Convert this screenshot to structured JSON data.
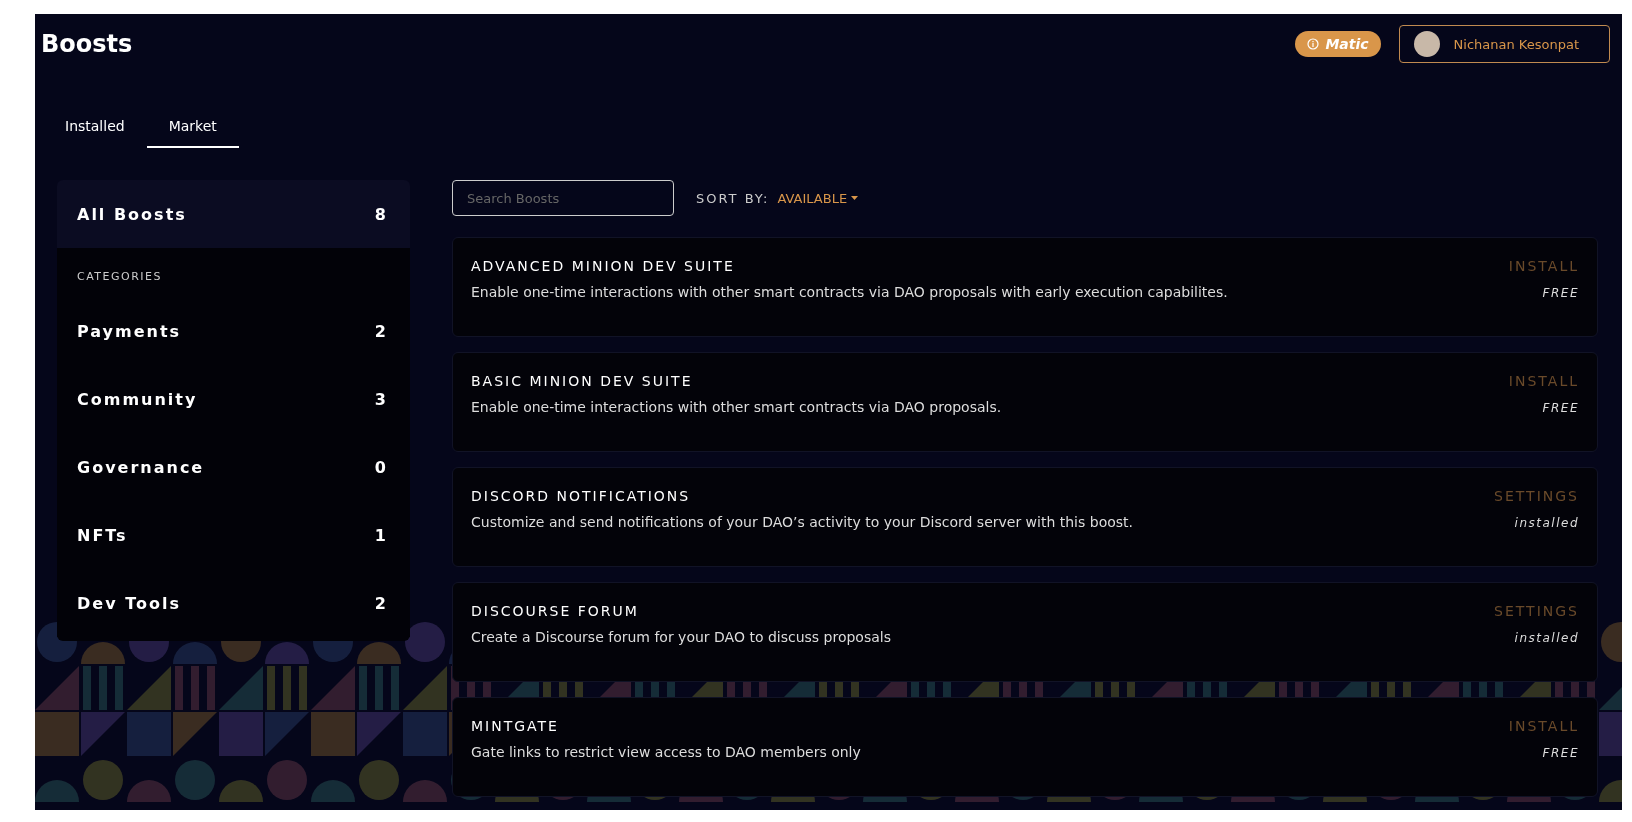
{
  "header": {
    "title": "Boosts",
    "network": "Matic",
    "user": "Nichanan Kesonpat"
  },
  "tabs": [
    {
      "label": "Installed",
      "selected": false
    },
    {
      "label": "Market",
      "selected": true
    }
  ],
  "sidebar": {
    "all": {
      "label": "All Boosts",
      "count": "8",
      "selected": true
    },
    "categories_heading": "CATEGORIES",
    "categories": [
      {
        "label": "Payments",
        "count": "2",
        "selected": false
      },
      {
        "label": "Community",
        "count": "3",
        "selected": false
      },
      {
        "label": "Governance",
        "count": "0",
        "selected": false
      },
      {
        "label": "NFTs",
        "count": "1",
        "selected": false
      },
      {
        "label": "Dev Tools",
        "count": "2",
        "selected": false
      }
    ]
  },
  "search": {
    "placeholder": "Search Boosts"
  },
  "sort": {
    "label": "SORT BY:",
    "value": "AVAILABLE"
  },
  "boosts": [
    {
      "title": "ADVANCED MINION DEV SUITE",
      "description": "Enable one-time interactions with other smart contracts via DAO proposals with early execution capabilites.",
      "action": "INSTALL",
      "status": "FREE"
    },
    {
      "title": "BASIC MINION DEV SUITE",
      "description": "Enable one-time interactions with other smart contracts via DAO proposals.",
      "action": "INSTALL",
      "status": "FREE"
    },
    {
      "title": "DISCORD NOTIFICATIONS",
      "description": "Customize and send notifications of your DAO’s activity to your Discord server with this boost.",
      "action": "SETTINGS",
      "status": "installed"
    },
    {
      "title": "DISCOURSE FORUM",
      "description": "Create a Discourse forum for your DAO to discuss proposals",
      "action": "SETTINGS",
      "status": "installed"
    },
    {
      "title": "MINTGATE",
      "description": "Gate links to restrict view access to DAO members only",
      "action": "INSTALL",
      "status": "FREE"
    }
  ]
}
